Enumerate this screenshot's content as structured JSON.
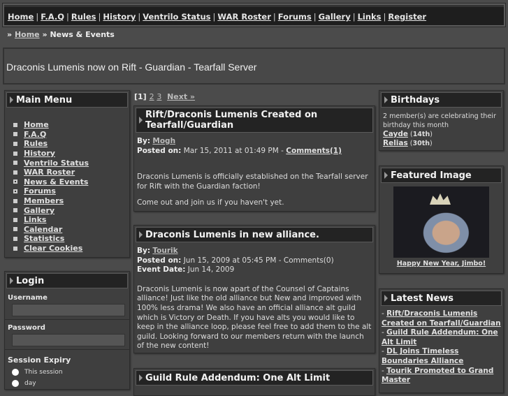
{
  "nav": [
    "Home",
    "F.A.Q",
    "Rules",
    "History",
    "Ventrilo Status",
    "WAR Roster",
    "Forums",
    "Gallery",
    "Links",
    "Register"
  ],
  "breadcrumb": {
    "sep": "»",
    "home": "Home",
    "current": "News & Events"
  },
  "banner": "Draconis Lumenis now on Rift - Guardian - Tearfall Server",
  "main_menu": {
    "title": "Main Menu",
    "items": [
      "Home",
      "F.A.Q",
      "Rules",
      "History",
      "Ventrilo Status",
      "WAR Roster",
      "News & Events",
      "Forums",
      "Members",
      "Gallery",
      "Links",
      "Calendar",
      "Statistics",
      "Clear Cookies"
    ]
  },
  "login": {
    "title": "Login",
    "username": "Username",
    "password": "Password",
    "expiry": "Session Expiry",
    "opt1": "This session",
    "opt2": "day"
  },
  "pagination": {
    "current": "[1]",
    "p2": "2",
    "p3": "3",
    "next": "Next »"
  },
  "posts": [
    {
      "title": "Rift/Draconis Lumenis Created on Tearfall/Guardian",
      "by_label": "By:",
      "author": "Mogh",
      "posted_label": "Posted on:",
      "posted": "Mar 15, 2011 at 01:49 PM - ",
      "comments": "Comments(1)",
      "p1": "Draconis Lumenis is officially established on the Tearfall server for Rift with the Guardian faction!",
      "p2": "Come out and join us if you haven't yet."
    },
    {
      "title": "Draconis Lumenis in new alliance.",
      "by_label": "By:",
      "author": "Tourik",
      "posted_label": "Posted on:",
      "posted": "Jun 15, 2009 at 05:45 PM - Comments(0)",
      "event_label": "Event Date:",
      "event": "Jun 14, 2009",
      "p1": "Draconis Lumenis is now apart of the Counsel of Captains alliance! Just like the old alliance but New and improved with 100% less drama! We also have an official alliance alt guild which is Victory or Death. If you have alts you would like to keep in the alliance loop, please feel free to add them to the alt guild. Looking forward to our members return with the launch of the new content!"
    },
    {
      "title": "Guild Rule Addendum: One Alt Limit"
    }
  ],
  "birthdays": {
    "title": "Birthdays",
    "text": "2 member(s) are celebrating their birthday this month",
    "m1": "Cayde",
    "d1": "14th",
    "m2": "Relias",
    "d2": "30th"
  },
  "featured": {
    "title": "Featured Image",
    "caption": "Happy New Year, Jimbo!"
  },
  "latest": {
    "title": "Latest News",
    "items": [
      "Rift/Draconis Lumenis Created on Tearfall/Guardian",
      "Guild Rule Addendum: One Alt Limit",
      "DL Joins Timeless Boundaries Alliance",
      "Tourik Promoted to Grand Master"
    ]
  }
}
